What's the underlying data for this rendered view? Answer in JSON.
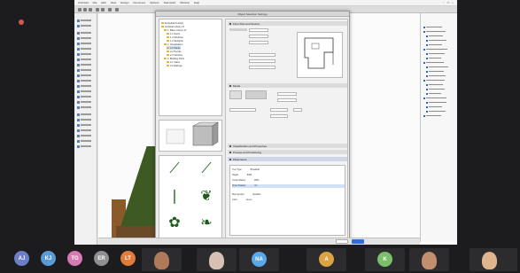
{
  "app": {
    "menu": [
      "Archicad",
      "File",
      "Edit",
      "View",
      "Design",
      "Document",
      "Options",
      "Teamwork",
      "Window",
      "Help"
    ],
    "dialog_title": "Object Selection Settings"
  },
  "dialog": {
    "library_tree": [
      "Embedded Library",
      "Archicad Library 27",
      "1. Basic Library 27",
      "1.1 Doors",
      "1.2 Windows",
      "1.3 Skylights",
      "2. Visualization",
      "2.1 Plants",
      "2.2 People",
      "2.3 Vehicles",
      "3. Building Parts",
      "3.1 Stairs",
      "3.2 Railings"
    ],
    "sections": [
      "Floor Plan and Section",
      "Model",
      "Classification and Properties",
      "Preview and Positioning",
      "Parameters"
    ],
    "params": [
      [
        "Tree Type",
        "Broadleaf"
      ],
      [
        "Height",
        "8000"
      ],
      [
        "Crown Radius",
        "2500"
      ],
      [
        "Show Shadow",
        "On"
      ],
      [
        "Plan Symbol",
        "Realistic"
      ],
      [
        "Color",
        "Green"
      ]
    ],
    "buttons": {
      "cancel": "Cancel",
      "ok": "OK"
    }
  },
  "participants": [
    {
      "initials": "AJ",
      "color": "#6b7ec6"
    },
    {
      "initials": "KJ",
      "color": "#5b9bd5"
    },
    {
      "initials": "TG",
      "color": "#d77ab2"
    },
    {
      "initials": "ER",
      "color": "#8e8e93"
    },
    {
      "initials": "LT",
      "color": "#e07b39"
    },
    {
      "initials": "NA",
      "color": "#5aa9e6"
    },
    {
      "initials": "A",
      "color": "#d9a441"
    },
    {
      "initials": "K",
      "color": "#7bbf6a"
    }
  ],
  "video_tiles": [
    {
      "name": "",
      "skin": "#b07a5a"
    },
    {
      "name": "",
      "skin": "#d7c0b4"
    },
    {
      "name": "",
      "skin": "#c18e6f"
    },
    {
      "name": "",
      "skin": "#e0b48f"
    }
  ]
}
